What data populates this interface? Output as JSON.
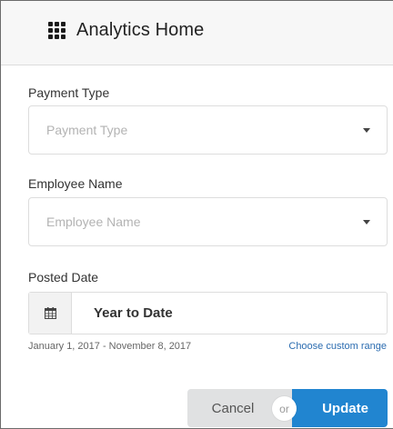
{
  "header": {
    "title": "Analytics Home",
    "icon": "grid-icon"
  },
  "filters": {
    "payment_type": {
      "label": "Payment Type",
      "placeholder": "Payment Type"
    },
    "employee_name": {
      "label": "Employee Name",
      "placeholder": "Employee Name"
    },
    "posted_date": {
      "label": "Posted Date",
      "value": "Year to Date",
      "range": "January 1, 2017 - November 8, 2017",
      "custom_link": "Choose custom range",
      "icon": "calendar-icon"
    }
  },
  "actions": {
    "cancel_label": "Cancel",
    "or_label": "or",
    "update_label": "Update"
  },
  "colors": {
    "primary": "#2185d0",
    "link": "#2b6cb0",
    "cancel_bg": "#e0e1e2"
  }
}
